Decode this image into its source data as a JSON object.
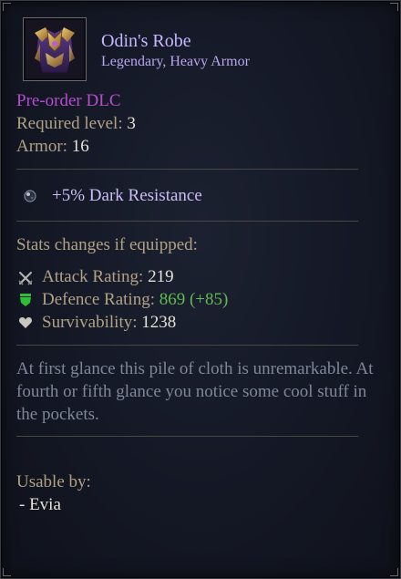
{
  "item": {
    "name": "Odin's Robe",
    "type": "Legendary, Heavy Armor",
    "icon": "robe-armor-icon"
  },
  "info": {
    "dlc": "Pre-order DLC",
    "required_level_label": "Required level:",
    "required_level_value": "3",
    "armor_label": "Armor:",
    "armor_value": "16"
  },
  "bonus": {
    "icon": "dark-orb-icon",
    "text": "+5% Dark Resistance"
  },
  "stats": {
    "header": "Stats changes if equipped:",
    "attack_label": "Attack Rating:",
    "attack_value": "219",
    "defence_label": "Defence Rating:",
    "defence_value": "869 (+85)",
    "survivability_label": "Survivability:",
    "survivability_value": "1238"
  },
  "description": "At first glance this pile of cloth is unremarkable. At fourth or fifth glance you notice some cool stuff in the pockets.",
  "usable": {
    "label": "Usable by:",
    "characters": [
      "- Evia"
    ]
  },
  "colors": {
    "name": "#c7b6ff",
    "dlc": "#b54dcf",
    "label": "#b1a285",
    "value": "#e7e2d6",
    "positive": "#5fbb52",
    "description": "#7f8799"
  }
}
